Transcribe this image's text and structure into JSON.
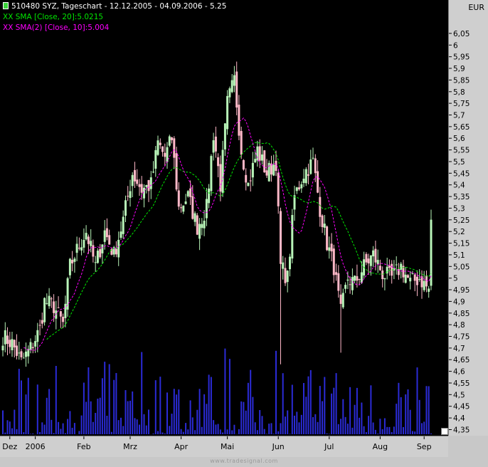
{
  "header": {
    "title": "510480  SYZ, Tageschart - 12.12.2005 - 04.09.2006 - 5.25",
    "sma20_label": "XX SMA [Close, 20]:5.0215",
    "sma10_label": "XX SMA(2) [Close, 10]:5.004",
    "currency": "EUR"
  },
  "footer": {
    "watermark": "www.tradesignal.com"
  },
  "colors": {
    "up_candle": "#b8f5b8",
    "down_candle": "#ffb8c8",
    "volume": "#2b2bd6",
    "sma20": "#00e600",
    "sma10": "#ff00ff"
  },
  "chart_data": {
    "type": "candlestick",
    "title": "510480  SYZ, Tageschart - 12.12.2005 - 04.09.2006 - 5.25",
    "ylabel": "EUR",
    "ylim": [
      4.33,
      6.12
    ],
    "y_ticks": [
      "6,05",
      "6",
      "5,95",
      "5,9",
      "5,85",
      "5,8",
      "5,75",
      "5,7",
      "5,65",
      "5,6",
      "5,55",
      "5,5",
      "5,45",
      "5,4",
      "5,35",
      "5,3",
      "5,25",
      "5,2",
      "5,15",
      "5,1",
      "5,05",
      "5",
      "4,95",
      "4,9",
      "4,85",
      "4,8",
      "4,75",
      "4,7",
      "4,65",
      "4,6",
      "4,55",
      "4,5",
      "4,45",
      "4,4",
      "4,35"
    ],
    "x_ticks": [
      "Dez",
      "2006",
      "Feb",
      "Mrz",
      "Apr",
      "Mai",
      "Jun",
      "Jul",
      "Aug",
      "Sep"
    ],
    "x_tick_positions": [
      3,
      14,
      35,
      55,
      77,
      97,
      119,
      141,
      163,
      182
    ],
    "n_days": 186,
    "close_anchors": [
      [
        0,
        4.75
      ],
      [
        4,
        4.72
      ],
      [
        8,
        4.64
      ],
      [
        12,
        4.7
      ],
      [
        16,
        4.78
      ],
      [
        18,
        4.9
      ],
      [
        22,
        4.88
      ],
      [
        26,
        4.8
      ],
      [
        29,
        5.05
      ],
      [
        32,
        5.12
      ],
      [
        36,
        5.2
      ],
      [
        40,
        5.05
      ],
      [
        44,
        5.2
      ],
      [
        48,
        5.1
      ],
      [
        52,
        5.25
      ],
      [
        56,
        5.45
      ],
      [
        60,
        5.38
      ],
      [
        64,
        5.4
      ],
      [
        67,
        5.58
      ],
      [
        70,
        5.52
      ],
      [
        73,
        5.6
      ],
      [
        76,
        5.3
      ],
      [
        80,
        5.35
      ],
      [
        84,
        5.22
      ],
      [
        88,
        5.3
      ],
      [
        91,
        5.62
      ],
      [
        94,
        5.4
      ],
      [
        97,
        5.75
      ],
      [
        100,
        5.85
      ],
      [
        103,
        5.55
      ],
      [
        106,
        5.4
      ],
      [
        110,
        5.55
      ],
      [
        114,
        5.45
      ],
      [
        118,
        5.5
      ],
      [
        120,
        5.05
      ],
      [
        123,
        5.0
      ],
      [
        126,
        5.35
      ],
      [
        130,
        5.45
      ],
      [
        134,
        5.5
      ],
      [
        137,
        5.3
      ],
      [
        140,
        5.15
      ],
      [
        143,
        5.05
      ],
      [
        146,
        4.85
      ],
      [
        149,
        5.0
      ],
      [
        152,
        4.98
      ],
      [
        156,
        5.05
      ],
      [
        160,
        5.1
      ],
      [
        164,
        5.02
      ],
      [
        168,
        5.0
      ],
      [
        172,
        5.05
      ],
      [
        176,
        4.98
      ],
      [
        180,
        5.0
      ],
      [
        184,
        4.95
      ],
      [
        185,
        5.25
      ]
    ],
    "volume_max": 8,
    "series": [
      {
        "name": "XX SMA [Close, 20]",
        "period": 20,
        "value_last": 5.0215
      },
      {
        "name": "XX SMA(2) [Close, 10]",
        "period": 10,
        "value_last": 5.004
      }
    ]
  }
}
